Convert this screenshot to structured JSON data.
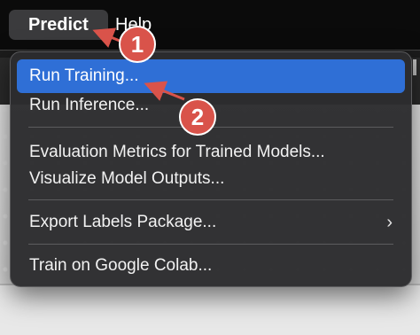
{
  "menubar": {
    "items": [
      {
        "label": "Predict",
        "active": true
      },
      {
        "label": "Help",
        "active": false
      }
    ]
  },
  "dropdown": {
    "items": [
      {
        "label": "Run Training...",
        "highlighted": true
      },
      {
        "label": "Run Inference..."
      },
      {
        "label": "Evaluation Metrics for Trained Models..."
      },
      {
        "label": "Visualize Model Outputs..."
      },
      {
        "label": "Export Labels Package...",
        "submenu_arrow": "›"
      },
      {
        "label": "Train on Google Colab..."
      }
    ]
  },
  "callouts": [
    {
      "number": "1"
    },
    {
      "number": "2"
    }
  ],
  "colors": {
    "highlight": "#2f6fd6",
    "callout": "#d9534a",
    "menu_background": "#2c2c2e",
    "menubar_background": "#0b0b0b"
  }
}
